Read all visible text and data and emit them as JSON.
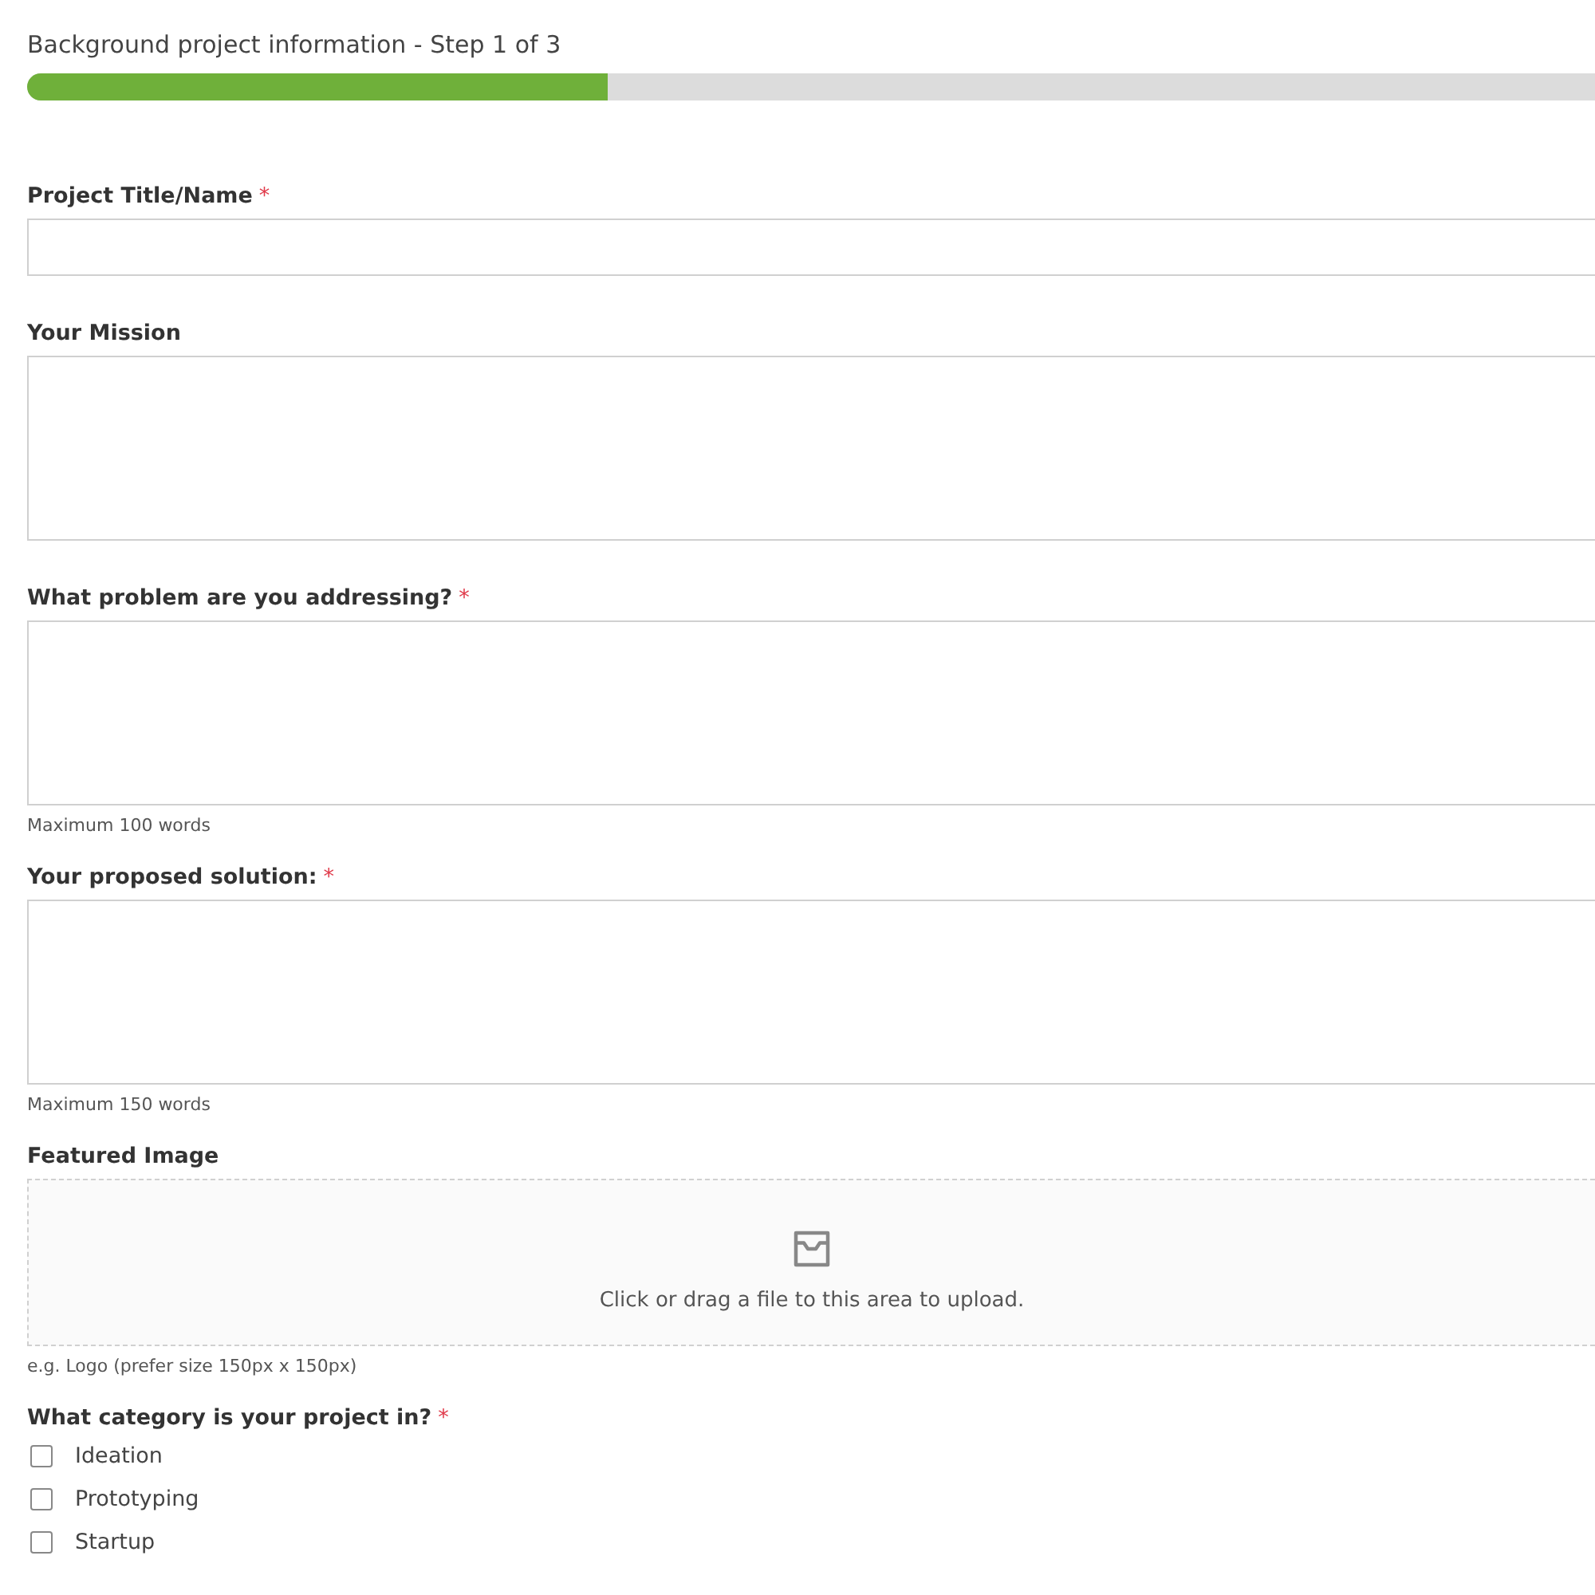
{
  "header": {
    "title": "Background project information - Step 1 of 3",
    "progress": {
      "level": 0.37
    }
  },
  "fields": [
    {
      "kind": "text",
      "label": "Project Title/Name",
      "required_mark": "*"
    },
    {
      "kind": "textarea",
      "label": "Your Mission"
    },
    {
      "kind": "textarea",
      "label": "What problem are you addressing?",
      "required_mark": "*",
      "hint": "Maximum 100 words"
    },
    {
      "kind": "textarea",
      "label": "Your proposed solution:",
      "required_mark": "*",
      "hint": "Maximum 150 words"
    },
    {
      "kind": "upload",
      "label": "Featured Image",
      "prompt": "Click or drag a file to this area to upload.",
      "hint": "e.g. Logo (prefer size 150px x 150px)"
    },
    {
      "kind": "checkboxes",
      "label": "What category is your project in?",
      "required_mark": "*",
      "options": [
        {
          "label": "Ideation",
          "checked": false
        },
        {
          "label": "Prototyping",
          "checked": false
        },
        {
          "label": "Startup",
          "checked": false
        }
      ]
    }
  ]
}
